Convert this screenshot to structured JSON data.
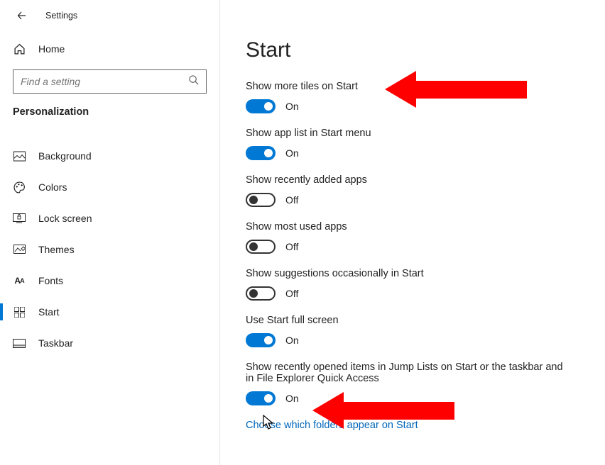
{
  "window_title": "Settings",
  "home_label": "Home",
  "search": {
    "placeholder": "Find a setting"
  },
  "section": "Personalization",
  "nav": [
    {
      "id": "background",
      "label": "Background"
    },
    {
      "id": "colors",
      "label": "Colors"
    },
    {
      "id": "lock-screen",
      "label": "Lock screen"
    },
    {
      "id": "themes",
      "label": "Themes"
    },
    {
      "id": "fonts",
      "label": "Fonts"
    },
    {
      "id": "start",
      "label": "Start",
      "active": true
    },
    {
      "id": "taskbar",
      "label": "Taskbar"
    }
  ],
  "page_title": "Start",
  "settings": [
    {
      "id": "more-tiles",
      "label": "Show more tiles on Start",
      "on": true,
      "state": "On"
    },
    {
      "id": "app-list",
      "label": "Show app list in Start menu",
      "on": true,
      "state": "On"
    },
    {
      "id": "recently-added",
      "label": "Show recently added apps",
      "on": false,
      "state": "Off"
    },
    {
      "id": "most-used",
      "label": "Show most used apps",
      "on": false,
      "state": "Off"
    },
    {
      "id": "suggestions",
      "label": "Show suggestions occasionally in Start",
      "on": false,
      "state": "Off"
    },
    {
      "id": "full-screen",
      "label": "Use Start full screen",
      "on": true,
      "state": "On"
    },
    {
      "id": "jump-lists",
      "label": "Show recently opened items in Jump Lists on Start or the taskbar and in File Explorer Quick Access",
      "on": true,
      "state": "On"
    }
  ],
  "link": "Choose which folders appear on Start"
}
